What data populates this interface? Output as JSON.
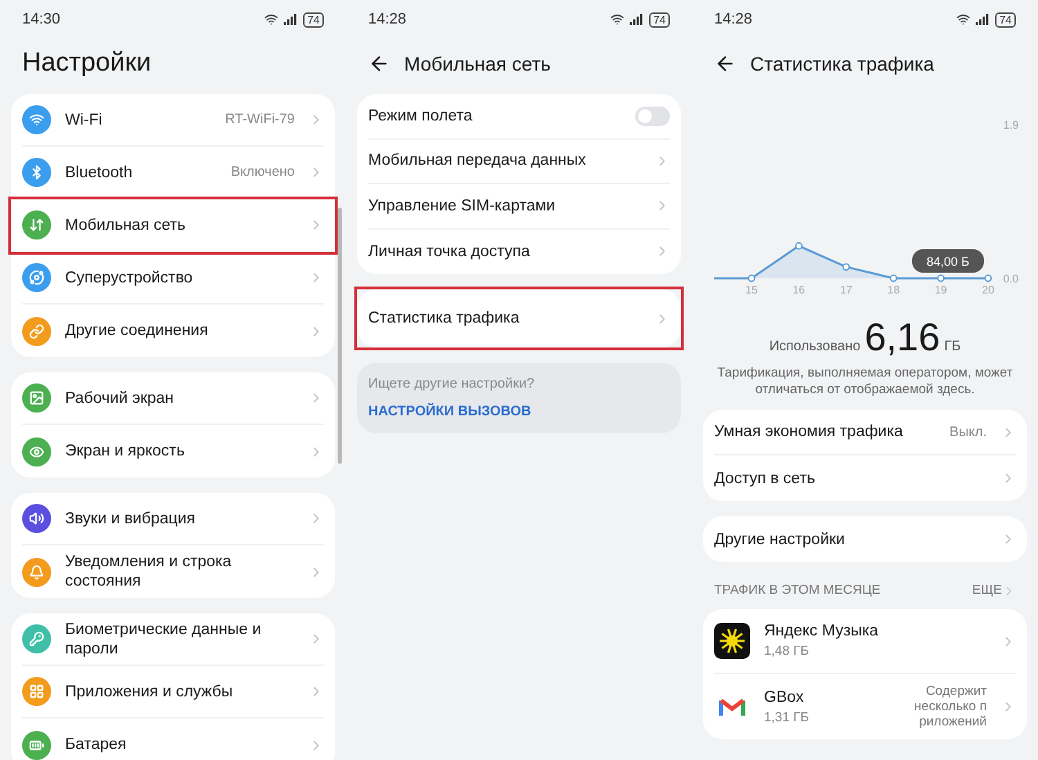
{
  "settings_screen": {
    "status_bar": {
      "time": "14:30",
      "battery": "74"
    },
    "title": "Настройки",
    "groups": [
      {
        "items": [
          {
            "label": "Wi-Fi",
            "value": "RT-WiFi-79",
            "color": "#3a9ded",
            "highlighted": false
          },
          {
            "label": "Bluetooth",
            "value": "Включено",
            "color": "#3a9ded",
            "highlighted": false
          },
          {
            "label": "Мобильная сеть",
            "color": "#4caf50",
            "highlighted": true
          },
          {
            "label": "Суперустройство",
            "color": "#3a9ded",
            "highlighted": false
          },
          {
            "label": "Другие соединения",
            "color": "#f29b1d",
            "highlighted": false
          }
        ]
      },
      {
        "items": [
          {
            "label": "Рабочий экран",
            "color": "#4caf50",
            "highlighted": false
          },
          {
            "label": "Экран и яркость",
            "color": "#4caf50",
            "highlighted": false
          }
        ]
      },
      {
        "items": [
          {
            "label": "Звуки и вибрация",
            "color": "#5a4fe0",
            "highlighted": false
          },
          {
            "label": "Уведомления и строка состояния",
            "color": "#f29b1d",
            "highlighted": false
          }
        ]
      },
      {
        "items": [
          {
            "label": "Биометрические данные и пароли",
            "color": "#3fbfa8",
            "highlighted": false
          },
          {
            "label": "Приложения и службы",
            "color": "#f29b1d",
            "highlighted": false
          },
          {
            "label": "Батарея",
            "color": "#4caf50",
            "highlighted": false
          }
        ]
      }
    ]
  },
  "mobile_network_screen": {
    "status_bar": {
      "time": "14:28",
      "battery": "74"
    },
    "title": "Мобильная сеть",
    "groups": [
      {
        "items": [
          {
            "kind": "toggle",
            "label": "Режим полета",
            "on": false,
            "highlighted": false
          },
          {
            "kind": "link",
            "label": "Мобильная передача данных",
            "highlighted": false
          },
          {
            "kind": "link",
            "label": "Управление SIM-картами",
            "highlighted": false
          },
          {
            "kind": "link",
            "label": "Личная точка доступа",
            "highlighted": false
          }
        ]
      },
      {
        "items": [
          {
            "kind": "link",
            "label": "Статистика трафика",
            "highlighted": true
          }
        ]
      }
    ],
    "suggestion": {
      "hint": "Ищете другие настройки?",
      "link": "НАСТРОЙКИ ВЫЗОВОВ"
    }
  },
  "traffic_screen": {
    "status_bar": {
      "time": "14:28",
      "battery": "74"
    },
    "title": "Статистика трафика",
    "chart_data": {
      "type": "area",
      "categories": [
        "15",
        "16",
        "17",
        "18",
        "19",
        "20"
      ],
      "series": [
        {
          "color": "#5b9bd5",
          "values": [
            0,
            0.4,
            0.14,
            0,
            0,
            0
          ]
        }
      ],
      "ylim": [
        0,
        1.9
      ],
      "yticks": [
        {
          "value": 0,
          "label": "0.0"
        },
        {
          "value": 1.9,
          "label": "1.9"
        }
      ],
      "annotations": [
        "84,00 Б"
      ]
    },
    "used_label": "Использовано",
    "used_value": "6,16",
    "used_unit": "ГБ",
    "note": "Тарификация, выполняемая оператором, может отличаться от отображаемой здесь.",
    "groups": [
      {
        "items": [
          {
            "label": "Умная экономия трафика",
            "value": "Выкл."
          },
          {
            "label": "Доступ в сеть"
          }
        ]
      },
      {
        "items": [
          {
            "label": "Другие настройки"
          }
        ]
      }
    ],
    "section": {
      "title": "ТРАФИК В ЭТОМ МЕСЯЦЕ",
      "more": "ЕЩЕ"
    },
    "apps": [
      {
        "name": "Яндекс Музыка",
        "usage": "1,48 ГБ"
      },
      {
        "name": "GBox",
        "usage": "1,31 ГБ",
        "note_lines": [
          "Содержит",
          "несколько п",
          "риложений"
        ]
      }
    ]
  }
}
